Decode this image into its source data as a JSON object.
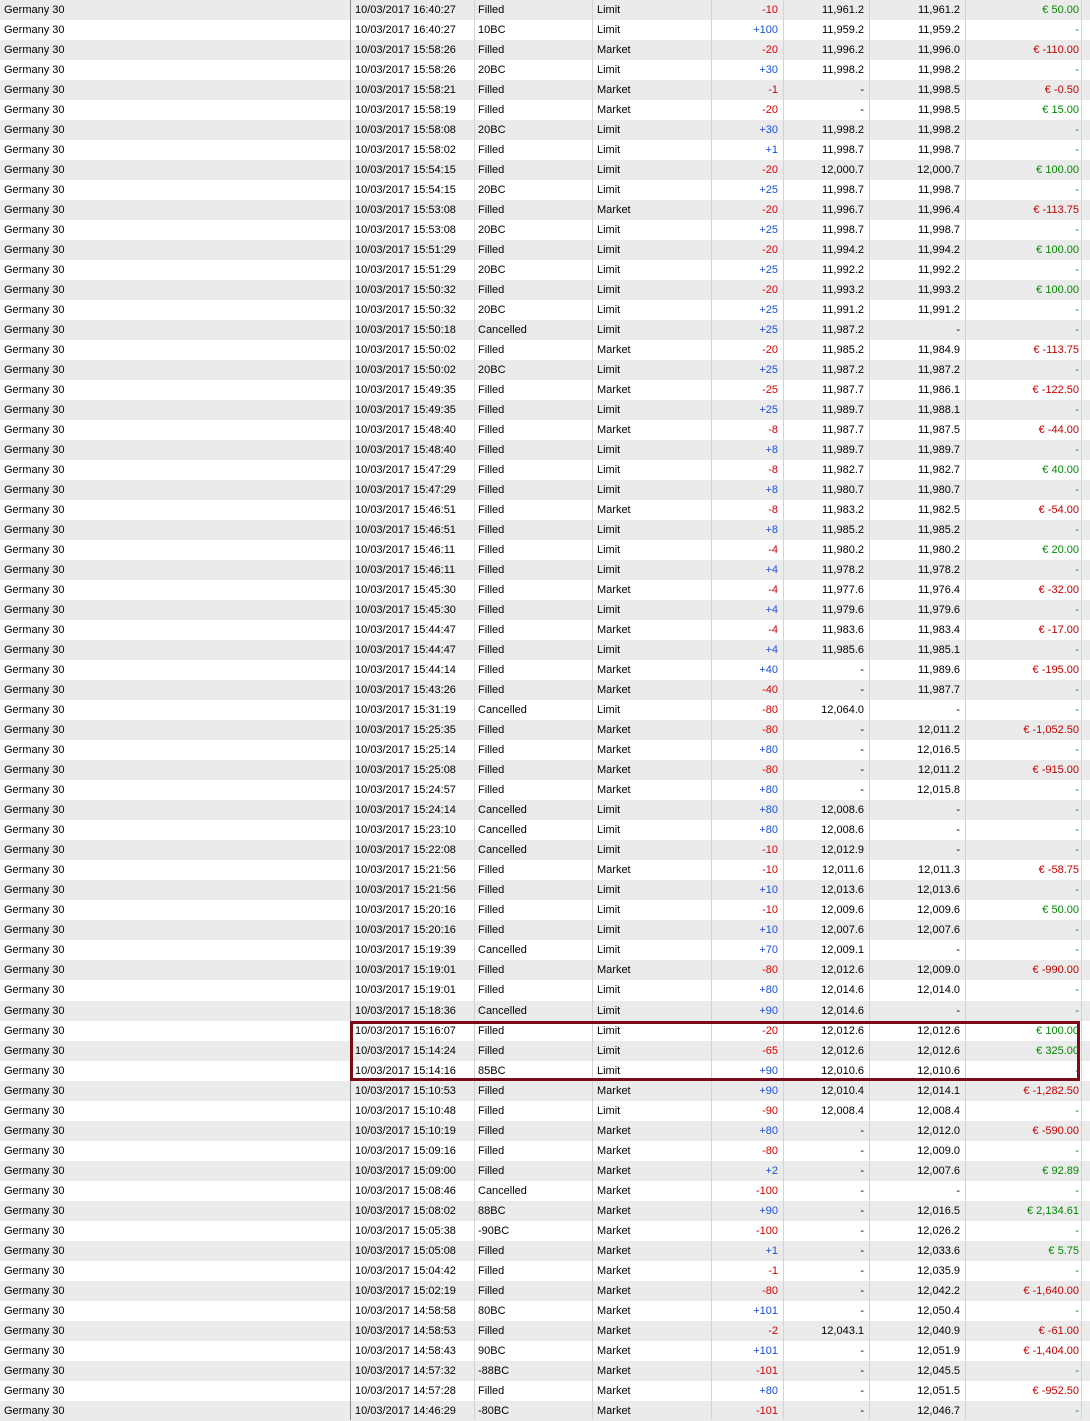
{
  "colors": {
    "row_alt": "#ebebeb",
    "positive_qty": "#1a4fd6",
    "negative_qty": "#d40000",
    "profit": "#008a00",
    "loss": "#c40000",
    "highlight_border": "#7b0a1a"
  },
  "rows": [
    {
      "m": "Germany 30",
      "t": "10/03/2017 16:40:27",
      "s": "Filled",
      "o": "Limit",
      "q": "-10",
      "p": "11,961.2",
      "a": "11,961.2",
      "pl": "€ 50.00"
    },
    {
      "m": "Germany 30",
      "t": "10/03/2017 16:40:27",
      "s": "10BC",
      "o": "Limit",
      "q": "+100",
      "p": "11,959.2",
      "a": "11,959.2",
      "pl": "-"
    },
    {
      "m": "Germany 30",
      "t": "10/03/2017 15:58:26",
      "s": "Filled",
      "o": "Market",
      "q": "-20",
      "p": "11,996.2",
      "a": "11,996.0",
      "pl": "€ -110.00"
    },
    {
      "m": "Germany 30",
      "t": "10/03/2017 15:58:26",
      "s": "20BC",
      "o": "Limit",
      "q": "+30",
      "p": "11,998.2",
      "a": "11,998.2",
      "pl": "-"
    },
    {
      "m": "Germany 30",
      "t": "10/03/2017 15:58:21",
      "s": "Filled",
      "o": "Market",
      "q": "-1",
      "p": "-",
      "a": "11,998.5",
      "pl": "€ -0.50"
    },
    {
      "m": "Germany 30",
      "t": "10/03/2017 15:58:19",
      "s": "Filled",
      "o": "Market",
      "q": "-20",
      "p": "-",
      "a": "11,998.5",
      "pl": "€ 15.00"
    },
    {
      "m": "Germany 30",
      "t": "10/03/2017 15:58:08",
      "s": "20BC",
      "o": "Limit",
      "q": "+30",
      "p": "11,998.2",
      "a": "11,998.2",
      "pl": "-"
    },
    {
      "m": "Germany 30",
      "t": "10/03/2017 15:58:02",
      "s": "Filled",
      "o": "Limit",
      "q": "+1",
      "p": "11,998.7",
      "a": "11,998.7",
      "pl": "-"
    },
    {
      "m": "Germany 30",
      "t": "10/03/2017 15:54:15",
      "s": "Filled",
      "o": "Limit",
      "q": "-20",
      "p": "12,000.7",
      "a": "12,000.7",
      "pl": "€ 100.00"
    },
    {
      "m": "Germany 30",
      "t": "10/03/2017 15:54:15",
      "s": "20BC",
      "o": "Limit",
      "q": "+25",
      "p": "11,998.7",
      "a": "11,998.7",
      "pl": "-"
    },
    {
      "m": "Germany 30",
      "t": "10/03/2017 15:53:08",
      "s": "Filled",
      "o": "Market",
      "q": "-20",
      "p": "11,996.7",
      "a": "11,996.4",
      "pl": "€ -113.75"
    },
    {
      "m": "Germany 30",
      "t": "10/03/2017 15:53:08",
      "s": "20BC",
      "o": "Limit",
      "q": "+25",
      "p": "11,998.7",
      "a": "11,998.7",
      "pl": "-"
    },
    {
      "m": "Germany 30",
      "t": "10/03/2017 15:51:29",
      "s": "Filled",
      "o": "Limit",
      "q": "-20",
      "p": "11,994.2",
      "a": "11,994.2",
      "pl": "€ 100.00"
    },
    {
      "m": "Germany 30",
      "t": "10/03/2017 15:51:29",
      "s": "20BC",
      "o": "Limit",
      "q": "+25",
      "p": "11,992.2",
      "a": "11,992.2",
      "pl": "-"
    },
    {
      "m": "Germany 30",
      "t": "10/03/2017 15:50:32",
      "s": "Filled",
      "o": "Limit",
      "q": "-20",
      "p": "11,993.2",
      "a": "11,993.2",
      "pl": "€ 100.00"
    },
    {
      "m": "Germany 30",
      "t": "10/03/2017 15:50:32",
      "s": "20BC",
      "o": "Limit",
      "q": "+25",
      "p": "11,991.2",
      "a": "11,991.2",
      "pl": "-"
    },
    {
      "m": "Germany 30",
      "t": "10/03/2017 15:50:18",
      "s": "Cancelled",
      "o": "Limit",
      "q": "+25",
      "p": "11,987.2",
      "a": "-",
      "pl": "-"
    },
    {
      "m": "Germany 30",
      "t": "10/03/2017 15:50:02",
      "s": "Filled",
      "o": "Market",
      "q": "-20",
      "p": "11,985.2",
      "a": "11,984.9",
      "pl": "€ -113.75"
    },
    {
      "m": "Germany 30",
      "t": "10/03/2017 15:50:02",
      "s": "20BC",
      "o": "Limit",
      "q": "+25",
      "p": "11,987.2",
      "a": "11,987.2",
      "pl": "-"
    },
    {
      "m": "Germany 30",
      "t": "10/03/2017 15:49:35",
      "s": "Filled",
      "o": "Market",
      "q": "-25",
      "p": "11,987.7",
      "a": "11,986.1",
      "pl": "€ -122.50"
    },
    {
      "m": "Germany 30",
      "t": "10/03/2017 15:49:35",
      "s": "Filled",
      "o": "Limit",
      "q": "+25",
      "p": "11,989.7",
      "a": "11,988.1",
      "pl": "-"
    },
    {
      "m": "Germany 30",
      "t": "10/03/2017 15:48:40",
      "s": "Filled",
      "o": "Market",
      "q": "-8",
      "p": "11,987.7",
      "a": "11,987.5",
      "pl": "€ -44.00"
    },
    {
      "m": "Germany 30",
      "t": "10/03/2017 15:48:40",
      "s": "Filled",
      "o": "Limit",
      "q": "+8",
      "p": "11,989.7",
      "a": "11,989.7",
      "pl": "-"
    },
    {
      "m": "Germany 30",
      "t": "10/03/2017 15:47:29",
      "s": "Filled",
      "o": "Limit",
      "q": "-8",
      "p": "11,982.7",
      "a": "11,982.7",
      "pl": "€ 40.00"
    },
    {
      "m": "Germany 30",
      "t": "10/03/2017 15:47:29",
      "s": "Filled",
      "o": "Limit",
      "q": "+8",
      "p": "11,980.7",
      "a": "11,980.7",
      "pl": "-"
    },
    {
      "m": "Germany 30",
      "t": "10/03/2017 15:46:51",
      "s": "Filled",
      "o": "Market",
      "q": "-8",
      "p": "11,983.2",
      "a": "11,982.5",
      "pl": "€ -54.00"
    },
    {
      "m": "Germany 30",
      "t": "10/03/2017 15:46:51",
      "s": "Filled",
      "o": "Limit",
      "q": "+8",
      "p": "11,985.2",
      "a": "11,985.2",
      "pl": "-"
    },
    {
      "m": "Germany 30",
      "t": "10/03/2017 15:46:11",
      "s": "Filled",
      "o": "Limit",
      "q": "-4",
      "p": "11,980.2",
      "a": "11,980.2",
      "pl": "€ 20.00"
    },
    {
      "m": "Germany 30",
      "t": "10/03/2017 15:46:11",
      "s": "Filled",
      "o": "Limit",
      "q": "+4",
      "p": "11,978.2",
      "a": "11,978.2",
      "pl": "-"
    },
    {
      "m": "Germany 30",
      "t": "10/03/2017 15:45:30",
      "s": "Filled",
      "o": "Market",
      "q": "-4",
      "p": "11,977.6",
      "a": "11,976.4",
      "pl": "€ -32.00"
    },
    {
      "m": "Germany 30",
      "t": "10/03/2017 15:45:30",
      "s": "Filled",
      "o": "Limit",
      "q": "+4",
      "p": "11,979.6",
      "a": "11,979.6",
      "pl": "-"
    },
    {
      "m": "Germany 30",
      "t": "10/03/2017 15:44:47",
      "s": "Filled",
      "o": "Market",
      "q": "-4",
      "p": "11,983.6",
      "a": "11,983.4",
      "pl": "€ -17.00"
    },
    {
      "m": "Germany 30",
      "t": "10/03/2017 15:44:47",
      "s": "Filled",
      "o": "Limit",
      "q": "+4",
      "p": "11,985.6",
      "a": "11,985.1",
      "pl": "-"
    },
    {
      "m": "Germany 30",
      "t": "10/03/2017 15:44:14",
      "s": "Filled",
      "o": "Market",
      "q": "+40",
      "p": "-",
      "a": "11,989.6",
      "pl": "€ -195.00"
    },
    {
      "m": "Germany 30",
      "t": "10/03/2017 15:43:26",
      "s": "Filled",
      "o": "Market",
      "q": "-40",
      "p": "-",
      "a": "11,987.7",
      "pl": "-"
    },
    {
      "m": "Germany 30",
      "t": "10/03/2017 15:31:19",
      "s": "Cancelled",
      "o": "Limit",
      "q": "-80",
      "p": "12,064.0",
      "a": "-",
      "pl": "-"
    },
    {
      "m": "Germany 30",
      "t": "10/03/2017 15:25:35",
      "s": "Filled",
      "o": "Market",
      "q": "-80",
      "p": "-",
      "a": "12,011.2",
      "pl": "€ -1,052.50"
    },
    {
      "m": "Germany 30",
      "t": "10/03/2017 15:25:14",
      "s": "Filled",
      "o": "Market",
      "q": "+80",
      "p": "-",
      "a": "12,016.5",
      "pl": "-"
    },
    {
      "m": "Germany 30",
      "t": "10/03/2017 15:25:08",
      "s": "Filled",
      "o": "Market",
      "q": "-80",
      "p": "-",
      "a": "12,011.2",
      "pl": "€ -915.00"
    },
    {
      "m": "Germany 30",
      "t": "10/03/2017 15:24:57",
      "s": "Filled",
      "o": "Market",
      "q": "+80",
      "p": "-",
      "a": "12,015.8",
      "pl": "-"
    },
    {
      "m": "Germany 30",
      "t": "10/03/2017 15:24:14",
      "s": "Cancelled",
      "o": "Limit",
      "q": "+80",
      "p": "12,008.6",
      "a": "-",
      "pl": "-"
    },
    {
      "m": "Germany 30",
      "t": "10/03/2017 15:23:10",
      "s": "Cancelled",
      "o": "Limit",
      "q": "+80",
      "p": "12,008.6",
      "a": "-",
      "pl": "-"
    },
    {
      "m": "Germany 30",
      "t": "10/03/2017 15:22:08",
      "s": "Cancelled",
      "o": "Limit",
      "q": "-10",
      "p": "12,012.9",
      "a": "-",
      "pl": "-"
    },
    {
      "m": "Germany 30",
      "t": "10/03/2017 15:21:56",
      "s": "Filled",
      "o": "Market",
      "q": "-10",
      "p": "12,011.6",
      "a": "12,011.3",
      "pl": "€ -58.75"
    },
    {
      "m": "Germany 30",
      "t": "10/03/2017 15:21:56",
      "s": "Filled",
      "o": "Limit",
      "q": "+10",
      "p": "12,013.6",
      "a": "12,013.6",
      "pl": "-"
    },
    {
      "m": "Germany 30",
      "t": "10/03/2017 15:20:16",
      "s": "Filled",
      "o": "Limit",
      "q": "-10",
      "p": "12,009.6",
      "a": "12,009.6",
      "pl": "€ 50.00"
    },
    {
      "m": "Germany 30",
      "t": "10/03/2017 15:20:16",
      "s": "Filled",
      "o": "Limit",
      "q": "+10",
      "p": "12,007.6",
      "a": "12,007.6",
      "pl": "-"
    },
    {
      "m": "Germany 30",
      "t": "10/03/2017 15:19:39",
      "s": "Cancelled",
      "o": "Limit",
      "q": "+70",
      "p": "12,009.1",
      "a": "-",
      "pl": "-"
    },
    {
      "m": "Germany 30",
      "t": "10/03/2017 15:19:01",
      "s": "Filled",
      "o": "Market",
      "q": "-80",
      "p": "12,012.6",
      "a": "12,009.0",
      "pl": "€ -990.00"
    },
    {
      "m": "Germany 30",
      "t": "10/03/2017 15:19:01",
      "s": "Filled",
      "o": "Limit",
      "q": "+80",
      "p": "12,014.6",
      "a": "12,014.0",
      "pl": "-"
    },
    {
      "m": "Germany 30",
      "t": "10/03/2017 15:18:36",
      "s": "Cancelled",
      "o": "Limit",
      "q": "+90",
      "p": "12,014.6",
      "a": "-",
      "pl": "-"
    },
    {
      "m": "Germany 30",
      "t": "10/03/2017 15:16:07",
      "s": "Filled",
      "o": "Limit",
      "q": "-20",
      "p": "12,012.6",
      "a": "12,012.6",
      "pl": "€ 100.00"
    },
    {
      "m": "Germany 30",
      "t": "10/03/2017 15:14:24",
      "s": "Filled",
      "o": "Limit",
      "q": "-65",
      "p": "12,012.6",
      "a": "12,012.6",
      "pl": "€ 325.00"
    },
    {
      "m": "Germany 30",
      "t": "10/03/2017 15:14:16",
      "s": "85BC",
      "o": "Limit",
      "q": "+90",
      "p": "12,010.6",
      "a": "12,010.6",
      "pl": "-"
    },
    {
      "m": "Germany 30",
      "t": "10/03/2017 15:10:53",
      "s": "Filled",
      "o": "Market",
      "q": "+90",
      "p": "12,010.4",
      "a": "12,014.1",
      "pl": "€ -1,282.50"
    },
    {
      "m": "Germany 30",
      "t": "10/03/2017 15:10:48",
      "s": "Filled",
      "o": "Limit",
      "q": "-90",
      "p": "12,008.4",
      "a": "12,008.4",
      "pl": "-"
    },
    {
      "m": "Germany 30",
      "t": "10/03/2017 15:10:19",
      "s": "Filled",
      "o": "Market",
      "q": "+80",
      "p": "-",
      "a": "12,012.0",
      "pl": "€ -590.00"
    },
    {
      "m": "Germany 30",
      "t": "10/03/2017 15:09:16",
      "s": "Filled",
      "o": "Market",
      "q": "-80",
      "p": "-",
      "a": "12,009.0",
      "pl": "-"
    },
    {
      "m": "Germany 30",
      "t": "10/03/2017 15:09:00",
      "s": "Filled",
      "o": "Market",
      "q": "+2",
      "p": "-",
      "a": "12,007.6",
      "pl": "€ 92.89"
    },
    {
      "m": "Germany 30",
      "t": "10/03/2017 15:08:46",
      "s": "Cancelled",
      "o": "Market",
      "q": "-100",
      "p": "-",
      "a": "-",
      "pl": "-"
    },
    {
      "m": "Germany 30",
      "t": "10/03/2017 15:08:02",
      "s": "88BC",
      "o": "Market",
      "q": "+90",
      "p": "-",
      "a": "12,016.5",
      "pl": "€ 2,134.61"
    },
    {
      "m": "Germany 30",
      "t": "10/03/2017 15:05:38",
      "s": "-90BC",
      "o": "Market",
      "q": "-100",
      "p": "-",
      "a": "12,026.2",
      "pl": "-"
    },
    {
      "m": "Germany 30",
      "t": "10/03/2017 15:05:08",
      "s": "Filled",
      "o": "Market",
      "q": "+1",
      "p": "-",
      "a": "12,033.6",
      "pl": "€ 5.75"
    },
    {
      "m": "Germany 30",
      "t": "10/03/2017 15:04:42",
      "s": "Filled",
      "o": "Market",
      "q": "-1",
      "p": "-",
      "a": "12,035.9",
      "pl": "-"
    },
    {
      "m": "Germany 30",
      "t": "10/03/2017 15:02:19",
      "s": "Filled",
      "o": "Market",
      "q": "-80",
      "p": "-",
      "a": "12,042.2",
      "pl": "€ -1,640.00"
    },
    {
      "m": "Germany 30",
      "t": "10/03/2017 14:58:58",
      "s": "80BC",
      "o": "Market",
      "q": "+101",
      "p": "-",
      "a": "12,050.4",
      "pl": "-"
    },
    {
      "m": "Germany 30",
      "t": "10/03/2017 14:58:53",
      "s": "Filled",
      "o": "Market",
      "q": "-2",
      "p": "12,043.1",
      "a": "12,040.9",
      "pl": "€ -61.00"
    },
    {
      "m": "Germany 30",
      "t": "10/03/2017 14:58:43",
      "s": "90BC",
      "o": "Market",
      "q": "+101",
      "p": "-",
      "a": "12,051.9",
      "pl": "€ -1,404.00"
    },
    {
      "m": "Germany 30",
      "t": "10/03/2017 14:57:32",
      "s": "-88BC",
      "o": "Market",
      "q": "-101",
      "p": "-",
      "a": "12,045.5",
      "pl": "-"
    },
    {
      "m": "Germany 30",
      "t": "10/03/2017 14:57:28",
      "s": "Filled",
      "o": "Market",
      "q": "+80",
      "p": "-",
      "a": "12,051.5",
      "pl": "€ -952.50"
    },
    {
      "m": "Germany 30",
      "t": "10/03/2017 14:46:29",
      "s": "-80BC",
      "o": "Market",
      "q": "-101",
      "p": "-",
      "a": "12,046.7",
      "pl": "-"
    }
  ]
}
